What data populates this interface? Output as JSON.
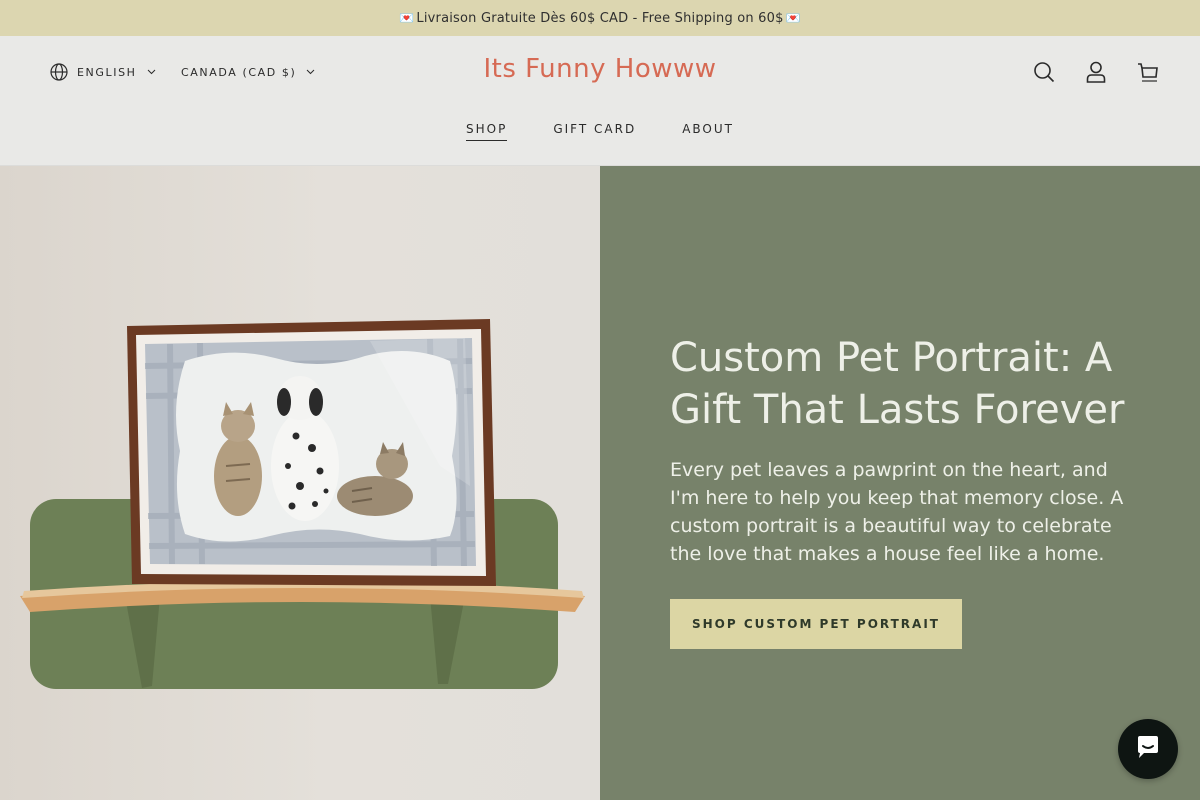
{
  "announcement": {
    "text": "Livraison Gratuite Dès 60$ CAD - Free Shipping on 60$",
    "heart": "💌"
  },
  "header": {
    "language": "ENGLISH",
    "currency": "CANADA (CAD $)",
    "logo": "Its Funny Howww",
    "nav": [
      "SHOP",
      "GIFT CARD",
      "ABOUT"
    ],
    "icons": [
      "search-icon",
      "account-icon",
      "cart-icon"
    ]
  },
  "hero": {
    "title": "Custom Pet Portrait: A Gift That Lasts Forever",
    "text": "Every pet leaves a pawprint on the heart, and I'm here to help you keep that memory close. A custom portrait is a beautiful way to celebrate the love that makes a house feel like a home.",
    "button": "SHOP CUSTOM PET PORTRAIT"
  },
  "colors": {
    "announcement_bg": "#dcd6b0",
    "logo": "#d66a54",
    "panel_bg": "#77826a",
    "button_bg": "#dcd6a4",
    "chat_bg": "#0e1512"
  }
}
